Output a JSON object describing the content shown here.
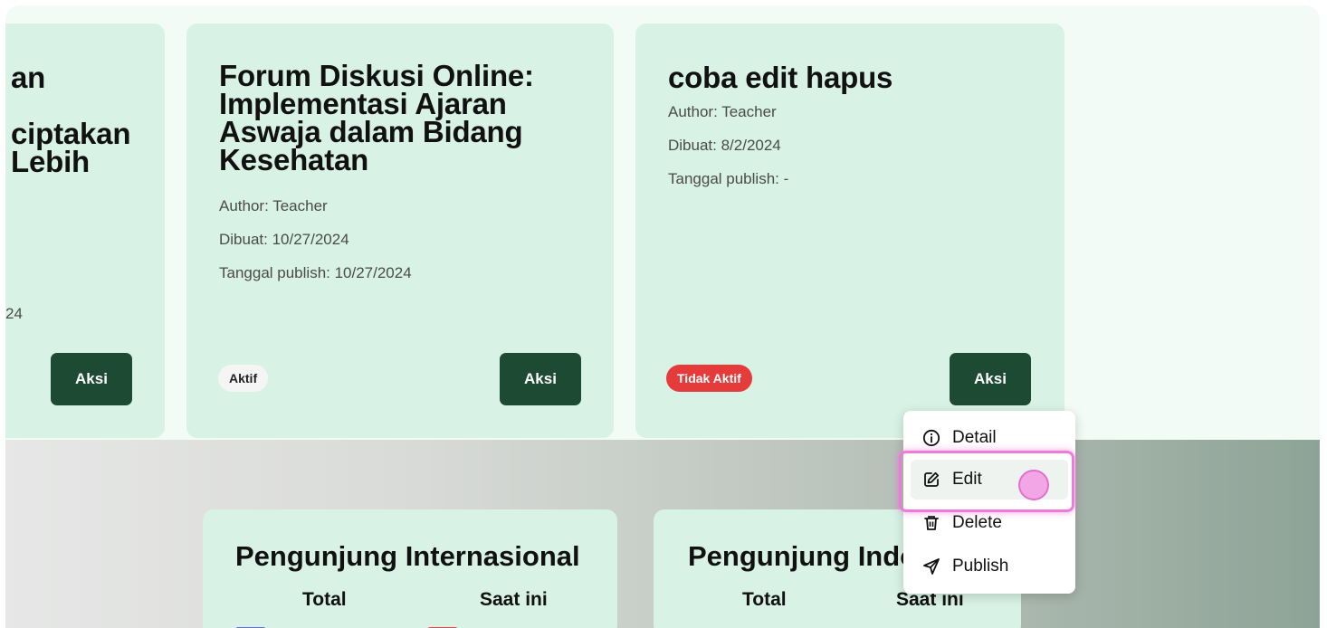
{
  "cards": [
    {
      "title_lines": [
        "an",
        "",
        "ciptakan",
        "Lebih"
      ],
      "meta_fragment": "24",
      "action_label": "Aksi"
    },
    {
      "title": "Forum Diskusi Online: Implementasi Ajaran Aswaja dalam Bidang Kesehatan",
      "author": "Author: Teacher",
      "created": "Dibuat: 10/27/2024",
      "published": "Tanggal publish: 10/27/2024",
      "status": "Aktif",
      "action_label": "Aksi"
    },
    {
      "title": "coba edit hapus",
      "author": "Author: Teacher",
      "created": "Dibuat: 8/2/2024",
      "published": "Tanggal publish: -",
      "status": "Tidak Aktif",
      "action_label": "Aksi"
    }
  ],
  "menu": {
    "items": [
      {
        "label": "Detail",
        "icon": "info-icon"
      },
      {
        "label": "Edit",
        "icon": "edit-icon"
      },
      {
        "label": "Delete",
        "icon": "trash-icon"
      },
      {
        "label": "Publish",
        "icon": "send-icon"
      }
    ]
  },
  "stats": [
    {
      "title": "Pengunjung Internasional",
      "total_label": "Total",
      "current_label": "Saat ini"
    },
    {
      "title": "Pengunjung Indonesia",
      "total_label": "Total",
      "current_label": "Saat ini"
    }
  ],
  "colors": {
    "card_bg": "#d8f2e6",
    "action_button": "#1d4a33",
    "badge_inactive": "#e53b3b",
    "highlight": "#f07ad8"
  }
}
